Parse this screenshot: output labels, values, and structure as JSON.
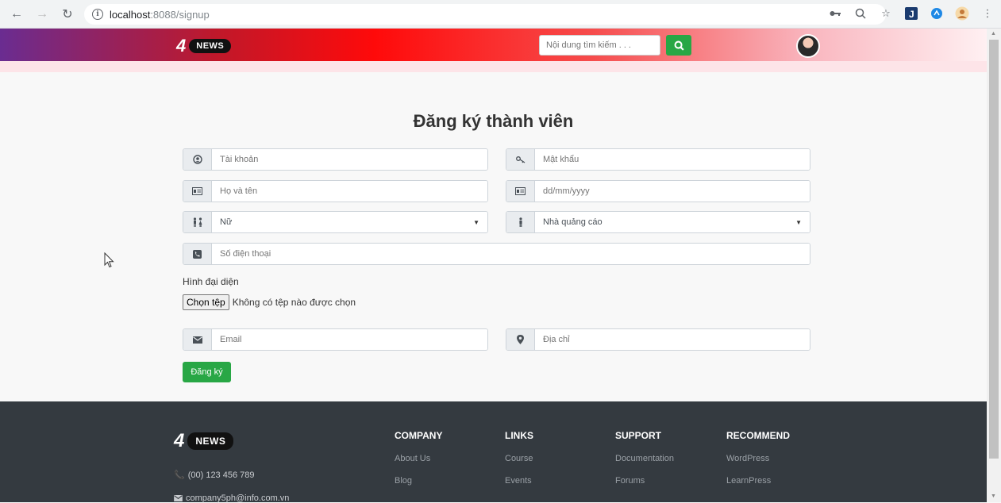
{
  "browser": {
    "url_host": "localhost",
    "url_path": ":8088/signup"
  },
  "navbar": {
    "logo_number": "4",
    "logo_text": "NEWS",
    "search_placeholder": "Nội dung tìm kiếm . . ."
  },
  "form": {
    "title": "Đăng ký thành viên",
    "username_placeholder": "Tài khoản",
    "password_placeholder": "Mật khẩu",
    "fullname_placeholder": "Họ và tên",
    "dob_placeholder": "dd/mm/yyyy",
    "gender_value": "Nữ",
    "role_value": "Nhà quảng cáo",
    "phone_placeholder": "Số điện thoại",
    "avatar_label": "Hình đại diện",
    "file_button": "Chọn tệp",
    "file_status": "Không có tệp nào được chọn",
    "email_placeholder": "Email",
    "address_placeholder": "Địa chỉ",
    "submit_label": "Đăng ký"
  },
  "footer": {
    "logo_number": "4",
    "logo_text": "NEWS",
    "phone": "(00) 123 456 789",
    "email": "company5ph@info.com.vn",
    "columns": [
      {
        "heading": "COMPANY",
        "links": [
          "About Us",
          "Blog"
        ]
      },
      {
        "heading": "LINKS",
        "links": [
          "Course",
          "Events"
        ]
      },
      {
        "heading": "SUPPORT",
        "links": [
          "Documentation",
          "Forums"
        ]
      },
      {
        "heading": "RECOMMEND",
        "links": [
          "WordPress",
          "LearnPress"
        ]
      }
    ]
  },
  "colors": {
    "accent_green": "#28a745",
    "footer_bg": "#343a40"
  }
}
